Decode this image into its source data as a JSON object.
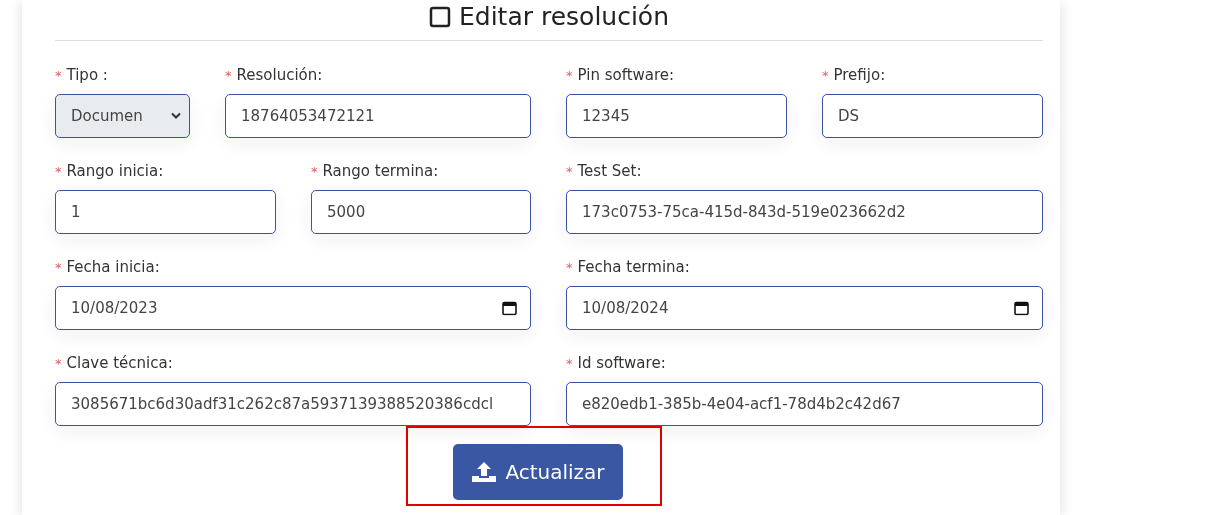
{
  "form": {
    "title": "Editar resolución",
    "rows": [
      [
        {
          "label": "Tipo :",
          "required_mark": "*",
          "kind": "select",
          "value": "Documen"
        },
        {
          "label": "Resolución:",
          "required_mark": "*",
          "kind": "text",
          "value": "18764053472121"
        },
        {
          "label": "Pin software:",
          "required_mark": "*",
          "kind": "text",
          "value": "12345"
        },
        {
          "label": "Prefijo:",
          "required_mark": "*",
          "kind": "text",
          "value": "DS"
        }
      ],
      [
        {
          "label": "Rango inicia:",
          "required_mark": "*",
          "kind": "text",
          "value": "1"
        },
        {
          "label": "Rango termina:",
          "required_mark": "*",
          "kind": "text",
          "value": "5000"
        },
        {
          "label": "Test Set:",
          "required_mark": "*",
          "kind": "text",
          "value": "173c0753-75ca-415d-843d-519e023662d2"
        }
      ],
      [
        {
          "label": "Fecha inicia:",
          "required_mark": "*",
          "kind": "date",
          "value": "10/08/2023"
        },
        {
          "label": "Fecha termina:",
          "required_mark": "*",
          "kind": "date",
          "value": "10/08/2024"
        }
      ],
      [
        {
          "label": "Clave técnica:",
          "required_mark": "*",
          "kind": "text",
          "value": "3085671bc6d30adf31c262c87a5937139388520386cdcl"
        },
        {
          "label": "Id software:",
          "required_mark": "*",
          "kind": "text",
          "value": "e820edb1-385b-4e04-acf1-78d4b2c42d67"
        }
      ]
    ],
    "submit": {
      "label": "Actualizar",
      "highlighted": true
    }
  }
}
